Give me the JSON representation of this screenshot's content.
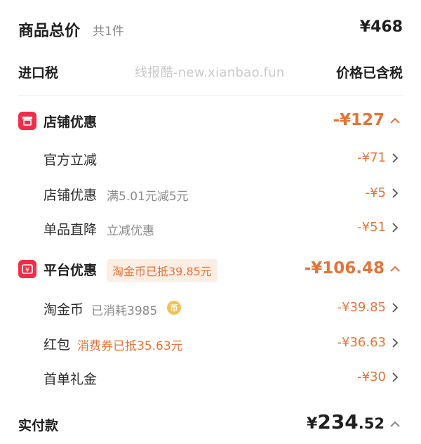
{
  "summary": {
    "title": "商品总价",
    "count": "共1件",
    "total": "¥468"
  },
  "tax": {
    "label": "进口税",
    "watermark": "线报酷-new.xianbao.fun",
    "value": "价格已含税"
  },
  "store_discount": {
    "icon": "store-icon",
    "title": "店铺优惠",
    "amount": "-¥127",
    "items": [
      {
        "label": "官方立减",
        "note": "",
        "amount": "-¥71"
      },
      {
        "label": "店铺优惠",
        "note": "满5.01元减5元",
        "amount": "-¥5"
      },
      {
        "label": "单品直降",
        "note": "立减优惠",
        "amount": "-¥51"
      }
    ]
  },
  "platform_discount": {
    "icon": "coupon-icon",
    "title": "平台优惠",
    "pill": "淘金币已抵39.85元",
    "amount": "-¥106.48",
    "items": [
      {
        "label": "淘金币",
        "note": "已消耗3985",
        "coin_glyph": "币",
        "amount": "-¥39.85"
      },
      {
        "label": "红包",
        "note": "消费券已抵35.63元",
        "amount": "-¥36.63"
      },
      {
        "label": "首单礼金",
        "note": "",
        "amount": "-¥30"
      }
    ]
  },
  "payment": {
    "label": "实付款",
    "currency": "¥",
    "integer": "234",
    "decimal": ".52"
  },
  "colors": {
    "accent": "#e2743a",
    "badge": "#ef2f4a",
    "pill_bg": "#fdeee3"
  }
}
